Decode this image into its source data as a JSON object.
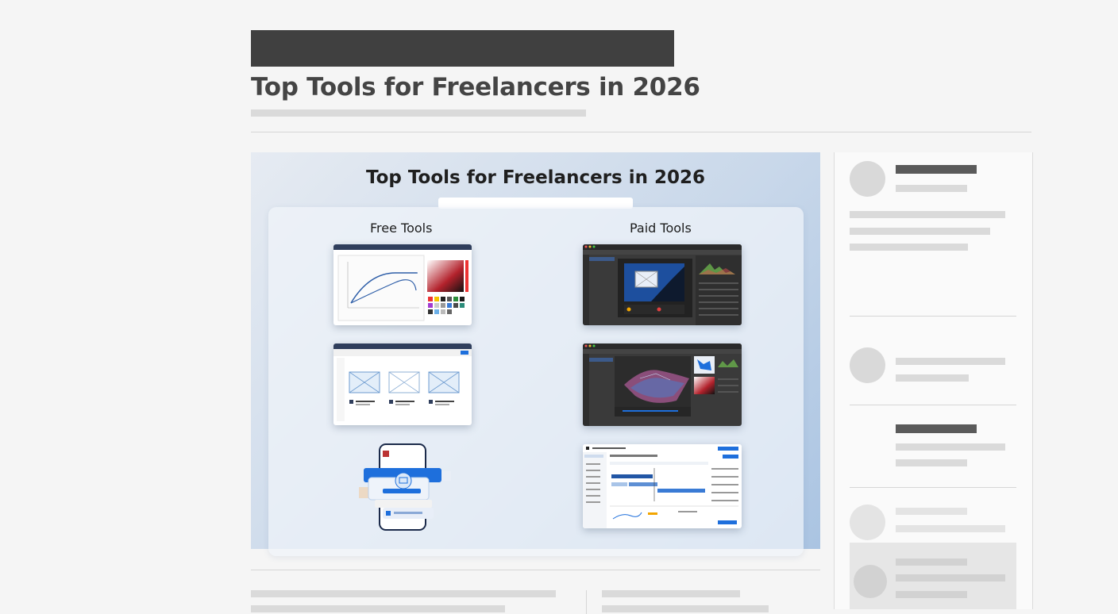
{
  "article": {
    "title": "Top Tools for Freelancers in 2026"
  },
  "hero": {
    "title": "Top Tools for Freelancers in 2026",
    "free_label": "Free Tools",
    "paid_label": "Paid Tools"
  },
  "colors": {
    "page_bg": "#f5f5f5",
    "placeholder_bar": "#dadada",
    "placeholder_dark": "#5a5a5a",
    "header_banner": "#404040",
    "accent_blue": "#1e6fdc"
  },
  "icons": [
    "avatar-icon",
    "image-placeholder-icon"
  ]
}
